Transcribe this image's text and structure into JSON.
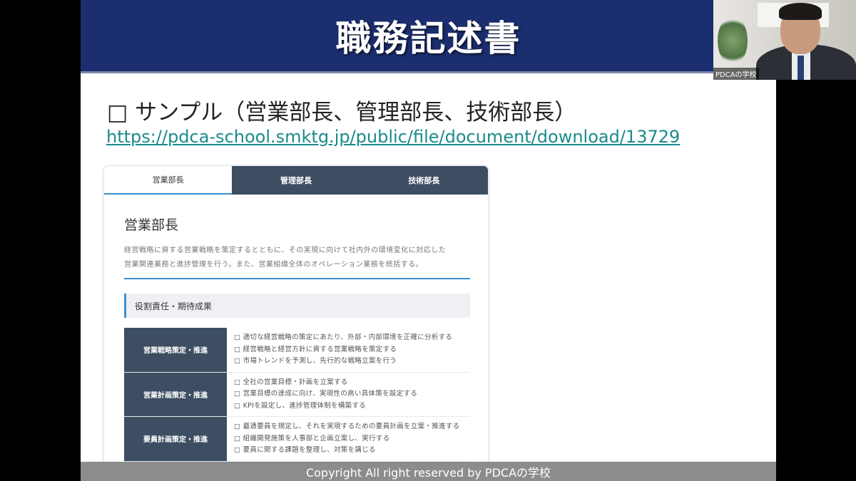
{
  "slide": {
    "title": "職務記述書",
    "subtitle": "□ サンプル（営業部長、管理部長、技術部長）",
    "link": "https://pdca-school.smktg.jp/public/file/document/download/13729"
  },
  "card": {
    "tabs": [
      {
        "label": "営業部長",
        "active": true
      },
      {
        "label": "管理部長",
        "active": false
      },
      {
        "label": "技術部長",
        "active": false
      }
    ],
    "role_title": "営業部長",
    "role_desc_line1": "経営戦略に資する営業戦略を策定するとともに、その実現に向けて社内外の環境変化に対応した",
    "role_desc_line2": "営業関連業務と進捗管理を行う。また、営業組織全体のオペレーション業務を統括する。",
    "section_heading": "役割責任・期待成果",
    "rows": [
      {
        "label": "営業戦略策定・推進",
        "items": [
          "□ 適切な経営戦略の策定にあたり、外部・内部環境を正確に分析する",
          "□ 経営戦略と経営方針に資する営業戦略を策定する",
          "□ 市場トレンドを予測し、先行的な戦略立案を行う"
        ]
      },
      {
        "label": "営業計画策定・推進",
        "items": [
          "□ 全社の営業目標・計画を立案する",
          "□ 営業目標の達成に向け、実現性の高い具体策を設定する",
          "□ KPIを設定し、進捗管理体制を構築する"
        ]
      },
      {
        "label": "要員計画策定・推進",
        "items": [
          "□ 最適要員を規定し、それを実現するための要員計画を立案・推進する",
          "□ 組織開発施策を人事部と企画立案し、実行する",
          "□ 要員に関する課題を整理し、対策を講じる"
        ]
      }
    ]
  },
  "footer": {
    "text": "Copyright All right reserved by PDCAの学校"
  },
  "webcam": {
    "label": "PDCAの学校"
  },
  "colors": {
    "title_bar": "#1b2e6f",
    "tab_inactive": "#3d4e63",
    "accent": "#3a8fcf",
    "link": "#1a8b8b",
    "footer": "#8c8c8c"
  }
}
